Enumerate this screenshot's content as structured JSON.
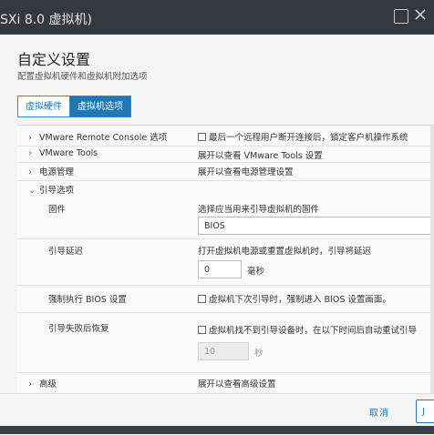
{
  "window": {
    "title": "SXi 8.0 虚拟机)"
  },
  "dialog": {
    "title": "自定义设置",
    "subtitle": "配置虚拟机硬件和虚拟机附加选项",
    "tabs": [
      {
        "label": "虚拟硬件",
        "active": false
      },
      {
        "label": "虚拟机选项",
        "active": true
      }
    ]
  },
  "settings": {
    "vmrc": {
      "label": "VMware Remote Console 选项",
      "checkbox_label": "最后一个远程用户断开连接后，锁定客户机操作系统",
      "checked": false
    },
    "tools": {
      "label": "VMware Tools",
      "value": "展开以查看 VMware Tools 设置"
    },
    "power": {
      "label": "电源管理",
      "value": "展开以查看电源管理设置"
    },
    "boot": {
      "label": "引导选项",
      "firmware": {
        "label": "固件",
        "hint": "选择应当用来引导虚拟机的固件",
        "value": "BIOS"
      },
      "delay": {
        "label": "引导延迟",
        "hint": "打开虚拟机电源或重置虚拟机时，引导将延迟",
        "value": "0",
        "unit": "毫秒"
      },
      "force_bios": {
        "label": "强制执行 BIOS 设置",
        "checkbox_label": "虚拟机下次引导时，强制进入 BIOS 设置画面。",
        "checked": false
      },
      "failed_recovery": {
        "label": "引导失败后恢复",
        "checkbox_label": "虚拟机找不到引导设备时，在以下时间后自动重试引导",
        "checked": false,
        "value": "10",
        "unit": "秒"
      }
    },
    "advanced": {
      "label": "高级",
      "value": "展开以查看高级设置"
    }
  },
  "footer": {
    "cancel_label": "取消",
    "ok_label": "J"
  },
  "colors": {
    "accent": "#1f78b4",
    "titlebar": "#33393e"
  }
}
